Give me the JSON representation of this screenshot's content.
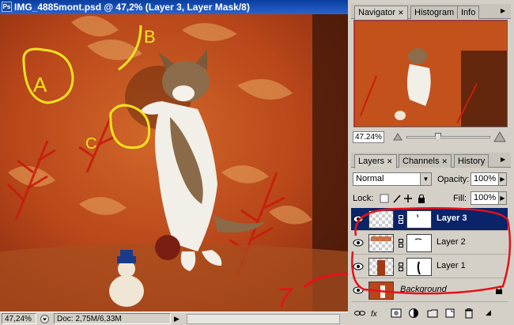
{
  "document": {
    "title": "IMG_4885mont.psd @ 47,2% (Layer 3, Layer Mask/8)",
    "app_icon": "Ps",
    "status": {
      "zoom": "47,24%",
      "doc_size": "Doc: 2,75M/6,33M"
    }
  },
  "annotations": {
    "a": "A",
    "b": "B",
    "c": "C",
    "seven": "7"
  },
  "navigator": {
    "tabs": [
      {
        "label": "Navigator"
      },
      {
        "label": "Histogram"
      },
      {
        "label": "Info"
      }
    ],
    "zoom": "47.24%"
  },
  "layers_panel": {
    "tabs": [
      {
        "label": "Layers"
      },
      {
        "label": "Channels"
      },
      {
        "label": "History"
      }
    ],
    "blend_mode": "Normal",
    "opacity_label": "Opacity:",
    "opacity": "100%",
    "lock_label": "Lock:",
    "fill_label": "Fill:",
    "fill": "100%",
    "layers": [
      {
        "name": "Layer 3",
        "selected": true
      },
      {
        "name": "Layer 2",
        "selected": false
      },
      {
        "name": "Layer 1",
        "selected": false
      },
      {
        "name": "Background",
        "selected": false,
        "locked": true
      }
    ]
  },
  "colors": {
    "title_bar": "#0a3e9f",
    "selected_layer": "#0a246a",
    "annotation_yellow": "#f5e21c",
    "annotation_red": "#e8101a",
    "sofa": "#c04a1a"
  }
}
